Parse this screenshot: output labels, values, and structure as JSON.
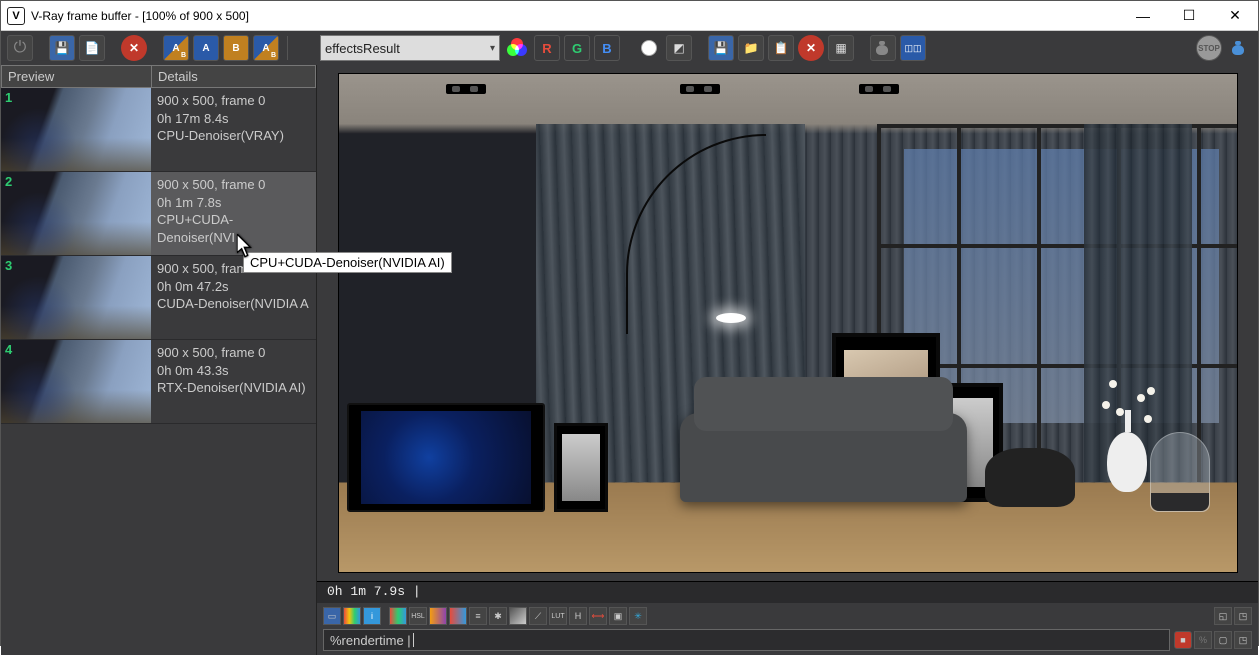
{
  "window": {
    "title": "V-Ray frame buffer - [100% of 900 x 500]",
    "logo": "V"
  },
  "channelSelect": "effectsResult",
  "toolbar2": {
    "R": "R",
    "G": "G",
    "B": "B"
  },
  "history": {
    "header_preview": "Preview",
    "header_details": "Details",
    "items": [
      {
        "res": "900 x 500, frame 0",
        "time": "0h 17m 8.4s",
        "mode": "CPU-Denoiser(VRAY)"
      },
      {
        "res": "900 x 500, frame 0",
        "time": "0h 1m 7.8s",
        "mode": "CPU+CUDA-Denoiser(NVI"
      },
      {
        "res": "900 x 500, frame 0",
        "time": "0h 0m 47.2s",
        "mode": "CUDA-Denoiser(NVIDIA A"
      },
      {
        "res": "900 x 500, frame 0",
        "time": "0h 0m 43.3s",
        "mode": "RTX-Denoiser(NVIDIA AI)"
      }
    ]
  },
  "tooltip": "CPU+CUDA-Denoiser(NVIDIA AI)",
  "status": "0h  1m  7.9s |",
  "inputText": "%rendertime |",
  "miniLabels": {
    "lut": "LUT",
    "h": "H",
    "i": "i",
    "hsl": "HSL"
  }
}
